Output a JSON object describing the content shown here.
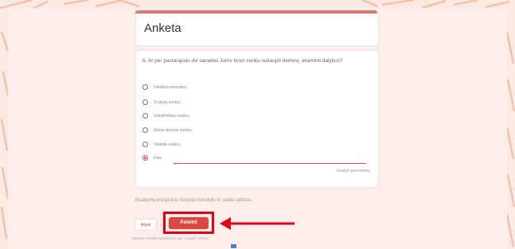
{
  "form": {
    "title": "Anketa",
    "question": "6. Ar per pastarąsias dvi savaites Jums buvo sunku sukaupti dėmesį, atsiminti dalykus?",
    "options": [
      {
        "label": "Visiškai nesunku;",
        "selected": false
      },
      {
        "label": "Truputį sunku;",
        "selected": false
      },
      {
        "label": "Vidutiniškai sunku;",
        "selected": false
      },
      {
        "label": "Gana dažnai sunku;",
        "selected": false
      },
      {
        "label": "Visada sunku;",
        "selected": false
      },
      {
        "label": "Kita:",
        "selected": true
      }
    ],
    "other_value": "",
    "clear_selection": "Išvalyti pasirinkimą",
    "copy_note": "Atsakymų kopija bus išsiųsta nurodytu el. pašto adresu.",
    "back_label": "Atgal",
    "submit_label": "Pateikti",
    "footer_note": "Niekada neteikite slaptažodžių per „Google“ formas."
  },
  "colors": {
    "accent": "#e9746a",
    "submit": "#dd4740",
    "highlight": "#e2001a",
    "selected_radio": "#e34d4d"
  }
}
